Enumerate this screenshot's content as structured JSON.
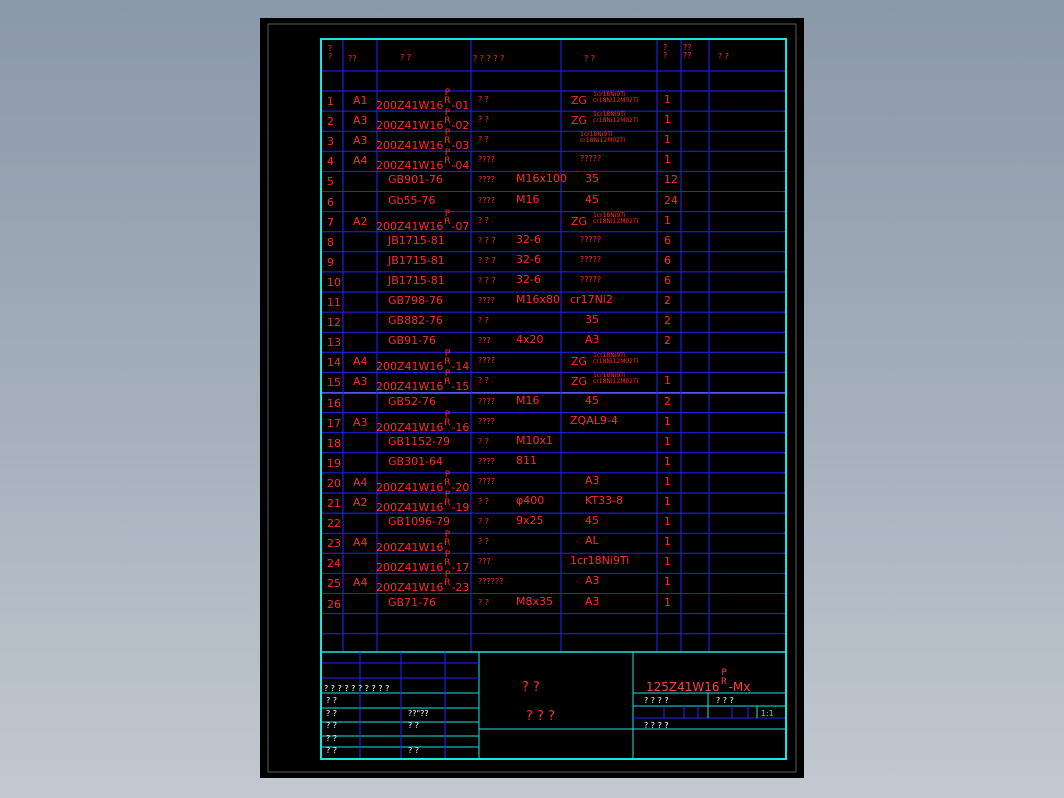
{
  "header": {
    "no": "? ?",
    "size": "??",
    "code": "?  ?",
    "name": "? ? ? ? ?",
    "material": "?   ?",
    "qty": "? ?",
    "c7": "?? ??",
    "remark": "?  ?"
  },
  "rows": [
    {
      "no": "1",
      "size": "A1",
      "code": "200Z41W16",
      "sub": "P R",
      "suffix": "-01",
      "name": "?   ?",
      "spec": "",
      "mat": "ZG",
      "mat_sub": "1cr18Ni9Ti cr18Ni12M02Ti",
      "qty": "1"
    },
    {
      "no": "2",
      "size": "A3",
      "code": "200Z41W16",
      "sub": "P R",
      "suffix": "-02",
      "name": "?   ?",
      "spec": "",
      "mat": "ZG",
      "mat_sub": "1cr18Ni9Ti cr18Ni12M02Ti",
      "qty": "1"
    },
    {
      "no": "3",
      "size": "A3",
      "code": "200Z41W16",
      "sub": "P R",
      "suffix": "-03",
      "name": "?   ?",
      "spec": "",
      "mat": "",
      "mat_sub": "1cr18Ni9Ti cr18Ni12M02Ti",
      "qty": "1"
    },
    {
      "no": "4",
      "size": "A4",
      "code": "200Z41W16",
      "sub": "P R",
      "suffix": "-04",
      "name": "????",
      "spec": "",
      "mat": "?????",
      "mat_sub": "",
      "qty": "1"
    },
    {
      "no": "5",
      "size": "",
      "code": "GB901-76",
      "sub": "",
      "suffix": "",
      "name": "????",
      "spec": "M16x100",
      "mat": "35",
      "mat_sub": "",
      "qty": "12"
    },
    {
      "no": "6",
      "size": "",
      "code": "Gb55-76",
      "sub": "",
      "suffix": "",
      "name": "????",
      "spec": "M16",
      "mat": "45",
      "mat_sub": "",
      "qty": "24"
    },
    {
      "no": "7",
      "size": "A2",
      "code": "200Z41W16",
      "sub": "P R",
      "suffix": "-07",
      "name": "?   ?",
      "spec": "",
      "mat": "ZG",
      "mat_sub": "1cr18Ni9Ti cr18Ni12M02Ti",
      "qty": "1"
    },
    {
      "no": "8",
      "size": "",
      "code": "JB1715-81",
      "sub": "",
      "suffix": "",
      "name": "? ? ?",
      "spec": "32-6",
      "mat": "?????",
      "mat_sub": "",
      "qty": "6"
    },
    {
      "no": "9",
      "size": "",
      "code": "JB1715-81",
      "sub": "",
      "suffix": "",
      "name": "? ? ?",
      "spec": "32-6",
      "mat": "?????",
      "mat_sub": "",
      "qty": "6"
    },
    {
      "no": "10",
      "size": "",
      "code": "JB1715-81",
      "sub": "",
      "suffix": "",
      "name": "? ? ?",
      "spec": "32-6",
      "mat": "?????",
      "mat_sub": "",
      "qty": "6"
    },
    {
      "no": "11",
      "size": "",
      "code": "GB798-76",
      "sub": "",
      "suffix": "",
      "name": "????",
      "spec": "M16x80",
      "mat": "cr17Ni2",
      "mat_sub": "",
      "qty": "2"
    },
    {
      "no": "12",
      "size": "",
      "code": "GB882-76",
      "sub": "",
      "suffix": "",
      "name": "?  ?",
      "spec": "",
      "mat": "35",
      "mat_sub": "",
      "qty": "2"
    },
    {
      "no": "13",
      "size": "",
      "code": "GB91-76",
      "sub": "",
      "suffix": "",
      "name": "???",
      "spec": "4x20",
      "mat": "A3",
      "mat_sub": "",
      "qty": "2"
    },
    {
      "no": "14",
      "size": "A4",
      "code": "200Z41W16",
      "sub": "P R",
      "suffix": "-14",
      "name": "????",
      "spec": "",
      "mat": "ZG",
      "mat_sub": "1cr18Ni9Ti cr18Ni12M02Ti",
      "qty": ""
    },
    {
      "no": "15",
      "size": "A3",
      "code": "200Z41W16",
      "sub": "P R",
      "suffix": "-15",
      "name": "?  ?",
      "spec": "",
      "mat": "ZG",
      "mat_sub": "1cr18Ni9Ti cr18Ni12M02Ti",
      "qty": "1"
    },
    {
      "no": "16",
      "size": "",
      "code": "GB52-76",
      "sub": "",
      "suffix": "",
      "name": "????",
      "spec": "M16",
      "mat": "45",
      "mat_sub": "",
      "qty": "2"
    },
    {
      "no": "17",
      "size": "A3",
      "code": "200Z41W16",
      "sub": "P R",
      "suffix": "-16",
      "name": "????",
      "spec": "",
      "mat": "ZQAL9-4",
      "mat_sub": "",
      "qty": "1"
    },
    {
      "no": "18",
      "size": "",
      "code": "GB1152-79",
      "sub": "",
      "suffix": "",
      "name": "?  ?",
      "spec": "M10x1",
      "mat": "",
      "mat_sub": "",
      "qty": "1"
    },
    {
      "no": "19",
      "size": "",
      "code": "GB301-64",
      "sub": "",
      "suffix": "",
      "name": "????",
      "spec": "811",
      "mat": "",
      "mat_sub": "",
      "qty": "1"
    },
    {
      "no": "20",
      "size": "A4",
      "code": "200Z41W16",
      "sub": "P R",
      "suffix": "-20",
      "name": "????",
      "spec": "",
      "mat": "A3",
      "mat_sub": "",
      "qty": "1"
    },
    {
      "no": "21",
      "size": "A2",
      "code": "200Z41W16",
      "sub": "P R",
      "suffix": "-19",
      "name": "?  ?",
      "spec": "φ400",
      "mat": "KT33-8",
      "mat_sub": "",
      "qty": "1"
    },
    {
      "no": "22",
      "size": "",
      "code": "GB1096-79",
      "sub": "",
      "suffix": "",
      "name": "?  ?",
      "spec": "9x25",
      "mat": "45",
      "mat_sub": "",
      "qty": "1"
    },
    {
      "no": "23",
      "size": "A4",
      "code": "200Z41W16",
      "sub": "P R",
      "suffix": "",
      "name": "?  ?",
      "spec": "",
      "mat": "AL",
      "mat_sub": "",
      "qty": "1"
    },
    {
      "no": "24",
      "size": "",
      "code": "200Z41W16",
      "sub": "P R",
      "suffix": "-17",
      "name": "???",
      "spec": "",
      "mat": "1cr18Ni9Ti",
      "mat_sub": "",
      "qty": "1"
    },
    {
      "no": "25",
      "size": "A4",
      "code": "200Z41W16",
      "sub": "P R",
      "suffix": "-23",
      "name": "??????",
      "spec": "",
      "mat": "A3",
      "mat_sub": "",
      "qty": "1"
    },
    {
      "no": "26",
      "size": "",
      "code": "GB71-76",
      "sub": "",
      "suffix": "",
      "name": "?  ?",
      "spec": "M8x35",
      "mat": "A3",
      "mat_sub": "",
      "qty": "1"
    }
  ],
  "title_block": {
    "left_header": "? ? ? ?  ?  ?  ?   ?   ?  ?",
    "left_rows": [
      {
        "a": "?  ?",
        "b": ""
      },
      {
        "a": "?  ?",
        "b": "??\"??"
      },
      {
        "a": "?  ?",
        "b": "?  ?"
      },
      {
        "a": "?  ?",
        "b": ""
      },
      {
        "a": "?  ?",
        "b": "?  ?"
      }
    ],
    "title_line1": "?      ?",
    "title_line2": "?  ?  ?",
    "drawing_no": "125Z41W16",
    "drawing_no_sub": "P R",
    "drawing_no_suffix": "-Mx",
    "attr_header_left": "?  ?  ?  ?",
    "attr_header_right": "?  ?  ?",
    "scale": "1:1",
    "bottom_labels": "?        ?       ?         ?"
  },
  "colors": {
    "line_blue": "#2323ff",
    "frame_cyan": "#18e5e5",
    "text_red": "#ff2a2a",
    "background": "#000000"
  }
}
